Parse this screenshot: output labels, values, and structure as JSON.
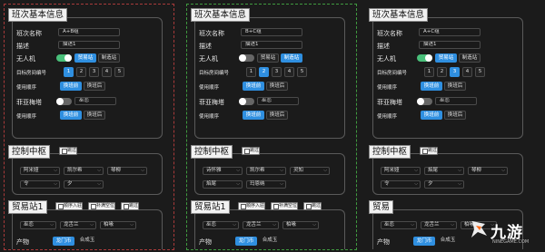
{
  "panels": [
    {
      "title": "班次基本信息",
      "name_label": "班次名称",
      "name_value": "A+B组",
      "desc_label": "描述",
      "desc_value": "描述1",
      "drone_label": "无人机",
      "drone_on": true,
      "drone_opts": [
        "贸易站",
        "制造站"
      ],
      "drone_active": 0,
      "room_label": "目标房间编号",
      "room_nums": [
        "1",
        "2",
        "3",
        "4",
        "5"
      ],
      "room_active": 0,
      "order_label": "使用顺序",
      "order_opts": [
        "换班前",
        "换班后"
      ],
      "order_active": 0,
      "fia_label": "菲亚梅塔",
      "fia_on": false,
      "fia_select": "巫恋",
      "order2_label": "使用顺序",
      "order2_opts": [
        "换班前",
        "换班后"
      ],
      "order2_active": 0,
      "ctrl_title": "控制中枢",
      "ctrl_skip": "跳过",
      "ctrl_ops": [
        "阿米娅",
        "凯尔希",
        "琴柳",
        "令",
        "夕"
      ],
      "trade_title": "贸易站1",
      "trade_opts": [
        "顺序入驻",
        "补满空位",
        "跳过"
      ],
      "trade_ops": [
        "巫恋",
        "龙舌兰",
        "柏喙"
      ],
      "product_label": "产物",
      "product_opts": [
        "龙门币",
        "合成玉"
      ],
      "product_active": 0
    },
    {
      "title": "班次基本信息",
      "name_label": "班次名称",
      "name_value": "B+C组",
      "desc_label": "描述",
      "desc_value": "描述1",
      "drone_label": "无人机",
      "drone_on": false,
      "drone_opts": [
        "贸易站",
        "制造站"
      ],
      "drone_active": 1,
      "room_label": "目标房间编号",
      "room_nums": [
        "1",
        "2",
        "3",
        "4",
        "5"
      ],
      "room_active": 1,
      "order_label": "使用顺序",
      "order_opts": [
        "换班前",
        "换班后"
      ],
      "order_active": 0,
      "fia_label": "菲亚梅塔",
      "fia_on": false,
      "fia_select": "巫恋",
      "order2_label": "使用顺序",
      "order2_opts": [
        "换班前",
        "换班后"
      ],
      "order2_active": 0,
      "ctrl_title": "控制中枢",
      "ctrl_skip": "跳过",
      "ctrl_ops": [
        "诗怀雅",
        "凯尔希",
        "灵知",
        "焰尾",
        "玛恩纳"
      ],
      "trade_title": "贸易站1",
      "trade_opts": [
        "顺序入驻",
        "补满空位",
        "跳过"
      ],
      "trade_ops": [
        "巫恋",
        "龙舌兰",
        "柏喙"
      ],
      "product_label": "产物",
      "product_opts": [
        "龙门币",
        "合成玉"
      ],
      "product_active": 0
    },
    {
      "title": "班次基本信息",
      "name_label": "班次名称",
      "name_value": "A+C组",
      "desc_label": "描述",
      "desc_value": "描述1",
      "drone_label": "无人机",
      "drone_on": true,
      "drone_opts": [
        "贸易站",
        "制造站"
      ],
      "drone_active": 0,
      "room_label": "目标房间编号",
      "room_nums": [
        "1",
        "2",
        "3",
        "4",
        "5"
      ],
      "room_active": 2,
      "order_label": "使用顺序",
      "order_opts": [
        "换班前",
        "换班后"
      ],
      "order_active": 0,
      "fia_label": "菲亚梅塔",
      "fia_on": false,
      "fia_select": "巫恋",
      "order2_label": "使用顺序",
      "order2_opts": [
        "换班前",
        "换班后"
      ],
      "order2_active": 0,
      "ctrl_title": "控制中枢",
      "ctrl_skip": "跳过",
      "ctrl_ops": [
        "阿米娅",
        "焰尾",
        "琴柳",
        "令",
        "夕"
      ],
      "trade_title": "贸易",
      "trade_opts": [],
      "trade_ops": [
        "巫恋",
        "龙舌兰",
        "柏喙"
      ],
      "product_label": "产物",
      "product_opts": [
        "龙门币",
        "合成玉"
      ],
      "product_active": 0
    }
  ],
  "watermark": {
    "text": "九游",
    "url": "NINEGAME.COM"
  },
  "colors": {
    "accent": "#2f8fe0",
    "toggle_on": "#49c07a",
    "border_red": "#a83a3a",
    "border_green": "#3f9a3f"
  }
}
